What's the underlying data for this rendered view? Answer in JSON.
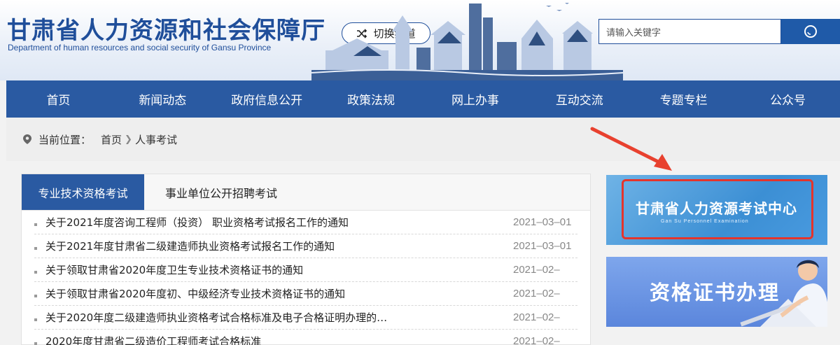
{
  "header": {
    "title": "甘肃省人力资源和社会保障厅",
    "subtitle": "Department of human resources and social security of Gansu Province",
    "switch_label": "切换频道",
    "search_placeholder": "请输入关键字"
  },
  "nav": [
    "首页",
    "新闻动态",
    "政府信息公开",
    "政策法规",
    "网上办事",
    "互动交流",
    "专题专栏",
    "公众号"
  ],
  "breadcrumb": {
    "prefix": "当前位置：",
    "home": "首页",
    "current": "人事考试"
  },
  "tabs": [
    {
      "label": "专业技术资格考试",
      "active": true
    },
    {
      "label": "事业单位公开招聘考试",
      "active": false
    }
  ],
  "news": [
    {
      "title": "关于2021年度咨询工程师（投资） 职业资格考试报名工作的通知",
      "date": "2021–03–01"
    },
    {
      "title": "关于2021年度甘肃省二级建造师执业资格考试报名工作的通知",
      "date": "2021–03–01"
    },
    {
      "title": "关于领取甘肃省2020年度卫生专业技术资格证书的通知",
      "date": "2021–02–"
    },
    {
      "title": "关于领取甘肃省2020年度初、中级经济专业技术资格证书的通知",
      "date": "2021–02–"
    },
    {
      "title": "关于2020年度二级建造师执业资格考试合格标准及电子合格证明办理的…",
      "date": "2021–02–"
    },
    {
      "title": "2020年度甘肃省二级造价工程师考试合格标准",
      "date": "2021–02–"
    }
  ],
  "banners": {
    "exam_center": {
      "title": "甘肃省人力资源考试中心",
      "subtitle": "Gan Su Personnel Examination"
    },
    "certificate": {
      "title": "资格证书办理"
    }
  },
  "colors": {
    "primary": "#2a5aa2",
    "highlight": "#e5342b"
  },
  "icons": {
    "switch": "shuffle-icon",
    "search": "search-icon",
    "location": "location-pin-icon"
  }
}
